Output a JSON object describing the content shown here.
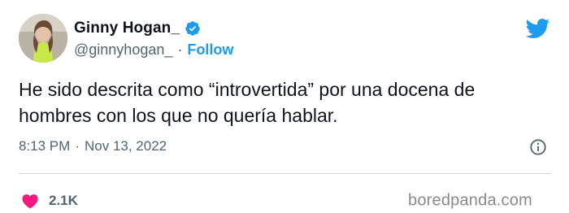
{
  "user": {
    "display_name": "Ginny Hogan_",
    "handle": "@ginnyhogan_",
    "separator": "·",
    "follow_label": "Follow"
  },
  "tweet": {
    "text": "He sido descrita como “introvertida” por una docena de\nhombres con los que no quería hablar.",
    "time": "8:13 PM",
    "meta_separator": "·",
    "date": "Nov 13, 2022"
  },
  "engagement": {
    "likes": "2.1K"
  },
  "watermark": "boredpanda.com",
  "colors": {
    "brand_blue": "#1d9bf0",
    "heart_pink": "#f91880",
    "text_primary": "#0f1419",
    "text_secondary": "#536471",
    "divider": "#cfd9de"
  },
  "icons": {
    "verified": "verified-badge-icon",
    "twitter": "twitter-bird-icon",
    "info": "info-icon",
    "like": "heart-icon"
  }
}
